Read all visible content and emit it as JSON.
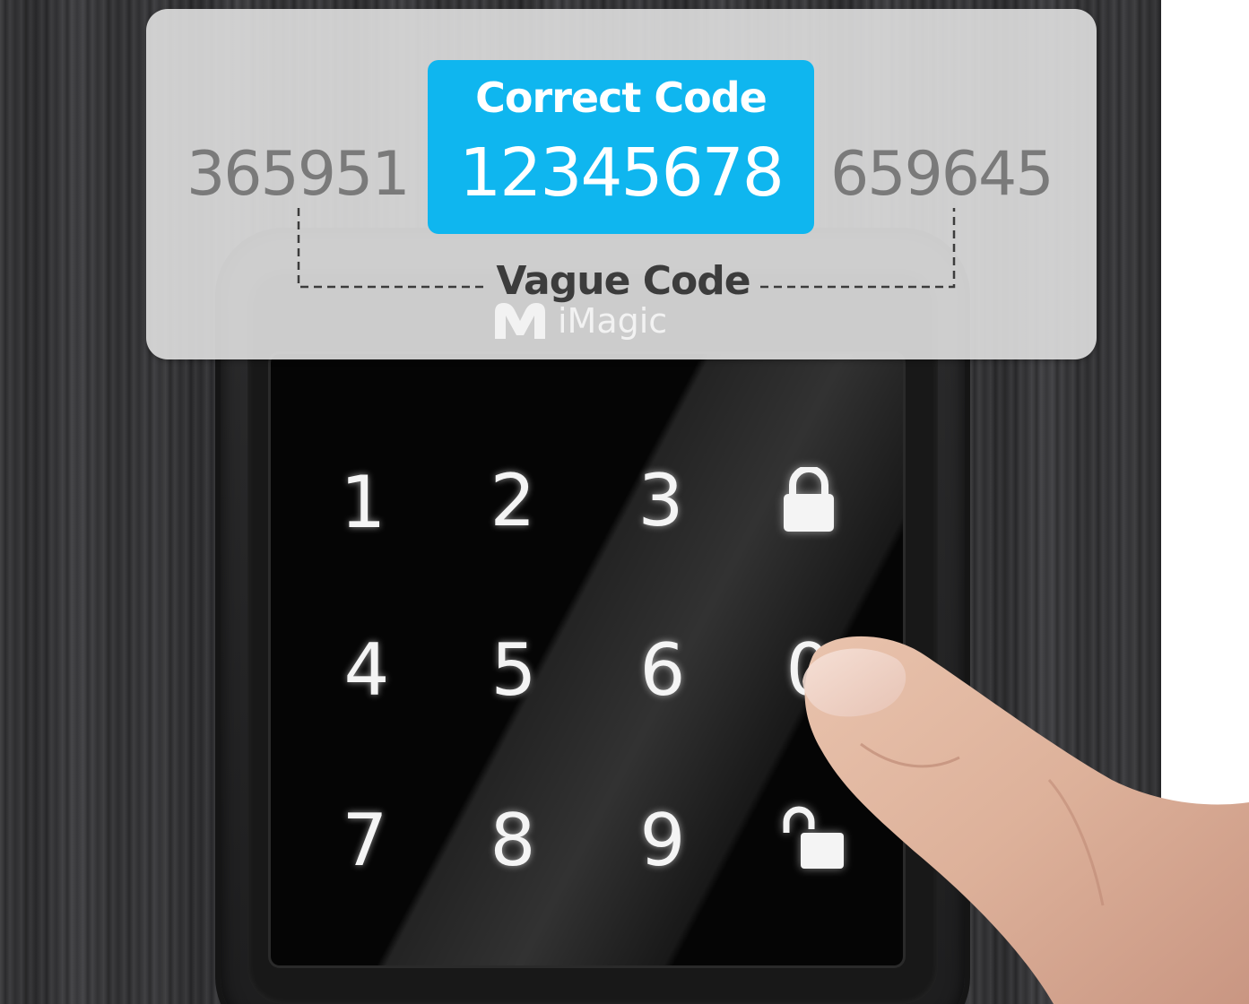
{
  "card": {
    "correct_title": "Correct Code",
    "correct_code": "12345678",
    "vague_left": "365951",
    "vague_right": "659645",
    "vague_label": "Vague Code"
  },
  "brand": {
    "name": "iMagic",
    "logo_icon": "m-logo-icon"
  },
  "keypad": {
    "keys": [
      "1",
      "2",
      "3",
      "lock",
      "4",
      "5",
      "6",
      "0",
      "7",
      "8",
      "9",
      "unlock"
    ]
  },
  "colors": {
    "accent": "#0fb6ef",
    "card": "#dcdcdc",
    "panel": "#050505"
  }
}
